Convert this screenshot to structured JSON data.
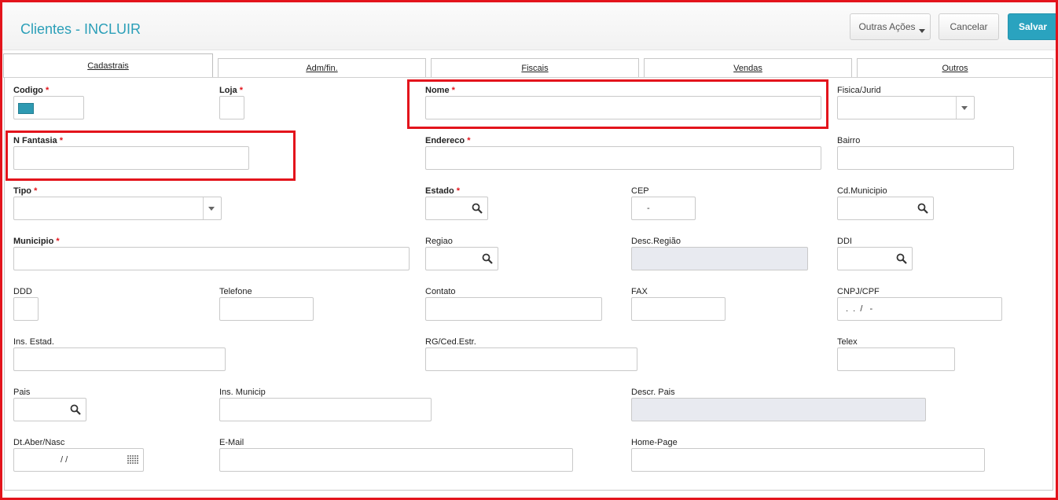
{
  "header": {
    "title": "Clientes - INCLUIR",
    "actions": {
      "outras": "Outras Ações",
      "cancelar": "Cancelar",
      "salvar": "Salvar"
    }
  },
  "tabs": [
    {
      "label": "Cadastrais",
      "active": true
    },
    {
      "label": "Adm/fin."
    },
    {
      "label": "Fiscais"
    },
    {
      "label": "Vendas"
    },
    {
      "label": "Outros"
    }
  ],
  "fields": {
    "codigo": {
      "label": "Codigo",
      "required": "*",
      "value": ""
    },
    "loja": {
      "label": "Loja",
      "required": "*",
      "value": ""
    },
    "nome": {
      "label": "Nome",
      "required": "*",
      "value": ""
    },
    "fisica_jurid": {
      "label": "Fisica/Jurid",
      "value": ""
    },
    "n_fantasia": {
      "label": "N Fantasia",
      "required": "*",
      "value": ""
    },
    "endereco": {
      "label": "Endereco",
      "required": "*",
      "value": ""
    },
    "bairro": {
      "label": "Bairro",
      "value": ""
    },
    "tipo": {
      "label": "Tipo",
      "required": "*",
      "value": ""
    },
    "estado": {
      "label": "Estado",
      "required": "*",
      "value": ""
    },
    "cep": {
      "label": "CEP",
      "mask": "-"
    },
    "cd_municipio": {
      "label": "Cd.Municipio",
      "value": ""
    },
    "municipio": {
      "label": "Municipio",
      "required": "*",
      "value": ""
    },
    "regiao": {
      "label": "Regiao",
      "value": ""
    },
    "desc_regiao": {
      "label": "Desc.Região",
      "value": ""
    },
    "ddi": {
      "label": "DDI",
      "value": ""
    },
    "ddd": {
      "label": "DDD",
      "value": ""
    },
    "telefone": {
      "label": "Telefone",
      "value": ""
    },
    "contato": {
      "label": "Contato",
      "value": ""
    },
    "fax": {
      "label": "FAX",
      "value": ""
    },
    "cnpj_cpf": {
      "label": "CNPJ/CPF",
      "mask": ".  .  /   -"
    },
    "ins_estad": {
      "label": "Ins. Estad.",
      "value": ""
    },
    "rg_ced_estr": {
      "label": "RG/Ced.Estr.",
      "value": ""
    },
    "telex": {
      "label": "Telex",
      "value": ""
    },
    "pais": {
      "label": "Pais",
      "value": ""
    },
    "ins_municip": {
      "label": "Ins. Municip",
      "value": ""
    },
    "descr_pais": {
      "label": "Descr. Pais",
      "value": ""
    },
    "dt_aber_nasc": {
      "label": "Dt.Aber/Nasc",
      "mask": "/ /"
    },
    "email": {
      "label": "E-Mail",
      "value": ""
    },
    "home_page": {
      "label": "Home-Page",
      "value": ""
    }
  },
  "colors": {
    "accent": "#2aa3bf",
    "title": "#2b9fb8",
    "highlight": "#e3141c",
    "readonly": "#e8eaf0"
  }
}
